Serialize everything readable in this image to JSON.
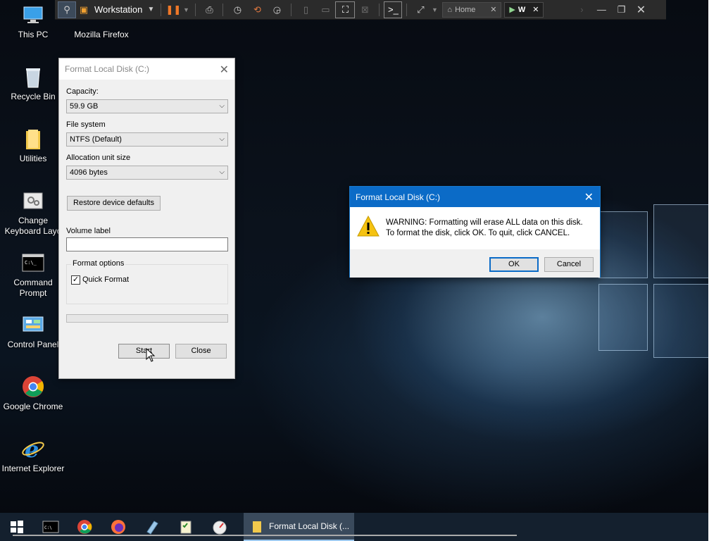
{
  "desktop": {
    "icons": [
      {
        "label": "This PC"
      },
      {
        "label": "Mozilla Firefox"
      },
      {
        "label": "Recycle Bin"
      },
      {
        "label": "Utilities"
      },
      {
        "label": "Change Keyboard Layo"
      },
      {
        "label": "Command Prompt"
      },
      {
        "label": "Control Panel"
      },
      {
        "label": "Google Chrome"
      },
      {
        "label": "Internet Explorer"
      }
    ]
  },
  "vm_toolbar": {
    "vm_name": "Workstation",
    "tabs": [
      {
        "label": "Home"
      },
      {
        "label": "W"
      }
    ]
  },
  "format_dialog": {
    "title": "Format Local Disk (C:)",
    "capacity_label": "Capacity:",
    "capacity_value": "59.9 GB",
    "filesystem_label": "File system",
    "filesystem_value": "NTFS (Default)",
    "alloc_label": "Allocation unit size",
    "alloc_value": "4096 bytes",
    "restore_button": "Restore device defaults",
    "volume_label": "Volume label",
    "volume_value": "",
    "format_options_label": "Format options",
    "quick_format_label": "Quick Format",
    "quick_format_checked": true,
    "progress": 0,
    "start_button": "Start",
    "close_button": "Close"
  },
  "warning_dialog": {
    "title": "Format Local Disk (C:)",
    "line1": "WARNING: Formatting will erase ALL data on this disk.",
    "line2": "To format the disk, click OK. To quit, click CANCEL.",
    "ok_button": "OK",
    "cancel_button": "Cancel"
  },
  "taskbar": {
    "active_window_label": "Format Local Disk (..."
  },
  "colors": {
    "accent": "#0b6bc7",
    "warning": "#f5c211"
  }
}
